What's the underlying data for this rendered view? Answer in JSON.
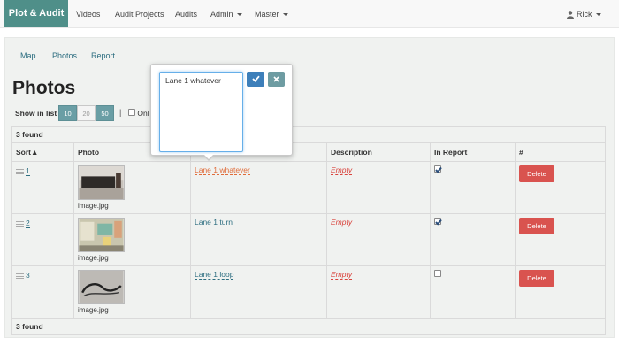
{
  "nav": {
    "brand": "Plot & Audit",
    "items": [
      "Videos",
      "Audit Projects",
      "Audits",
      "Admin",
      "Master"
    ],
    "user": "Rick"
  },
  "subnav": [
    "Map",
    "Photos",
    "Report"
  ],
  "page_title": "Photos",
  "pagination": {
    "label": "Show in list",
    "options": [
      "10",
      "20",
      "50"
    ],
    "selected": [
      "10",
      "50"
    ],
    "only_label": "Onl"
  },
  "found_text": "3 found",
  "table": {
    "headers": [
      "Sort▲",
      "Photo",
      "",
      "Description",
      "In Report",
      "#"
    ],
    "rows": [
      {
        "sort": "1",
        "file": "image.jpg",
        "title": "Lane 1 whatever",
        "description": "Empty",
        "in_report": true,
        "action": "Delete"
      },
      {
        "sort": "2",
        "file": "image.jpg",
        "title": "Lane 1 turn",
        "description": "Empty",
        "in_report": true,
        "action": "Delete"
      },
      {
        "sort": "3",
        "file": "image.jpg",
        "title": "Lane 1 loop",
        "description": "Empty",
        "in_report": false,
        "action": "Delete"
      }
    ]
  },
  "editor": {
    "value": "Lane 1 whatever",
    "ok_icon": "checkmark-icon",
    "cancel_icon": "close-icon"
  },
  "colors": {
    "brand": "#4f8f89",
    "link": "#2d6e80",
    "danger": "#d9534f",
    "primary": "#3d7fba"
  }
}
